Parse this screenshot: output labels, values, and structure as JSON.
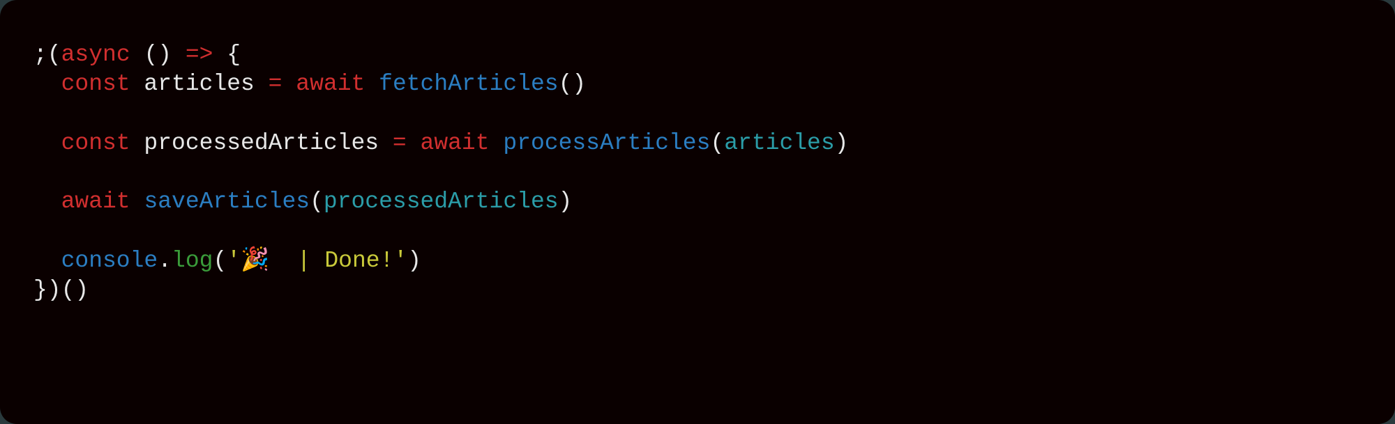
{
  "code": {
    "line1": {
      "t1": ";(",
      "t2": "async",
      "t3": " () ",
      "t4": "=>",
      "t5": " {"
    },
    "line2": {
      "t1": "const",
      "t2": " articles ",
      "t3": "=",
      "t4": " ",
      "t5": "await",
      "t6": " ",
      "t7": "fetchArticles",
      "t8": "()"
    },
    "line3": {
      "t1": "const",
      "t2": " processedArticles ",
      "t3": "=",
      "t4": " ",
      "t5": "await",
      "t6": " ",
      "t7": "processArticles",
      "t8": "(",
      "t9": "articles",
      "t10": ")"
    },
    "line4": {
      "t1": "await",
      "t2": " ",
      "t3": "saveArticles",
      "t4": "(",
      "t5": "processedArticles",
      "t6": ")"
    },
    "line5": {
      "t1": "console",
      "t2": ".",
      "t3": "log",
      "t4": "(",
      "t5": "'🎉  | Done!'",
      "t6": ")"
    },
    "line6": {
      "t1": "})()"
    }
  }
}
